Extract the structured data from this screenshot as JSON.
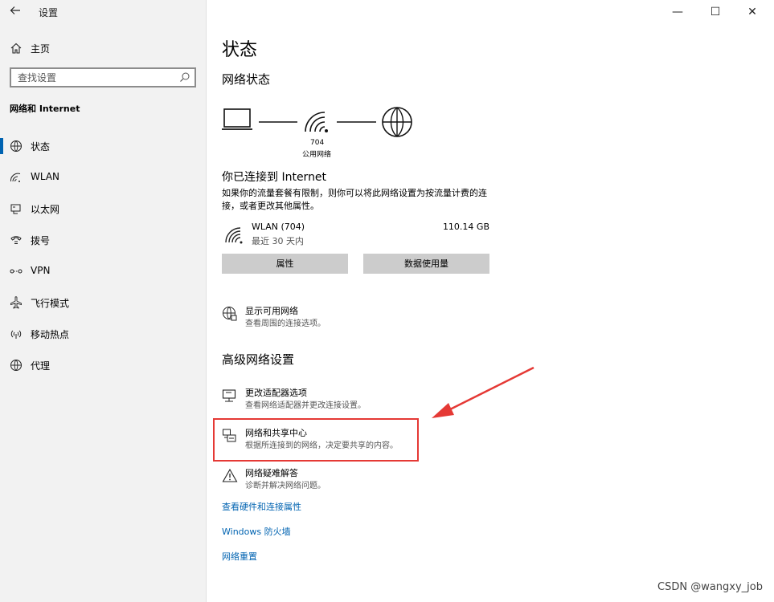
{
  "window": {
    "title": "设置",
    "controls": {
      "minimize": "—",
      "maximize": "☐",
      "close": "✕"
    }
  },
  "sidebar": {
    "home_label": "主页",
    "search_placeholder": "查找设置",
    "section_title": "网络和 Internet",
    "items": [
      {
        "label": "状态",
        "icon": "status-icon",
        "active": true
      },
      {
        "label": "WLAN",
        "icon": "wifi-icon",
        "active": false
      },
      {
        "label": "以太网",
        "icon": "ethernet-icon",
        "active": false
      },
      {
        "label": "拨号",
        "icon": "dialup-icon",
        "active": false
      },
      {
        "label": "VPN",
        "icon": "vpn-icon",
        "active": false
      },
      {
        "label": "飞行模式",
        "icon": "airplane-icon",
        "active": false
      },
      {
        "label": "移动热点",
        "icon": "hotspot-icon",
        "active": false
      },
      {
        "label": "代理",
        "icon": "globe-icon",
        "active": false
      }
    ]
  },
  "main": {
    "title": "状态",
    "network_status_heading": "网络状态",
    "diagram": {
      "network_name": "704",
      "network_type": "公用网络"
    },
    "connected_heading": "你已连接到 Internet",
    "connected_desc": "如果你的流量套餐有限制，则你可以将此网络设置为按流量计费的连接，或者更改其他属性。",
    "connection": {
      "name": "WLAN (704)",
      "sub": "最近 30 天内",
      "usage": "110.14 GB"
    },
    "buttons": {
      "properties": "属性",
      "data_usage": "数据使用量"
    },
    "show_networks": {
      "title": "显示可用网络",
      "sub": "查看周围的连接选项。"
    },
    "advanced_heading": "高级网络设置",
    "adapter": {
      "title": "更改适配器选项",
      "sub": "查看网络适配器并更改连接设置。"
    },
    "sharing_center": {
      "title": "网络和共享中心",
      "sub": "根据所连接到的网络，决定要共享的内容。"
    },
    "troubleshoot": {
      "title": "网络疑难解答",
      "sub": "诊断并解决网络问题。"
    },
    "links": {
      "hardware": "查看硬件和连接属性",
      "firewall": "Windows 防火墙",
      "reset": "网络重置"
    }
  },
  "annotation": {
    "highlight_color": "#e53935"
  },
  "watermark": "CSDN @wangxy_job",
  "colors": {
    "accent": "#0063b1",
    "sidebar_bg": "#f2f2f2",
    "button_bg": "#cccccc"
  }
}
